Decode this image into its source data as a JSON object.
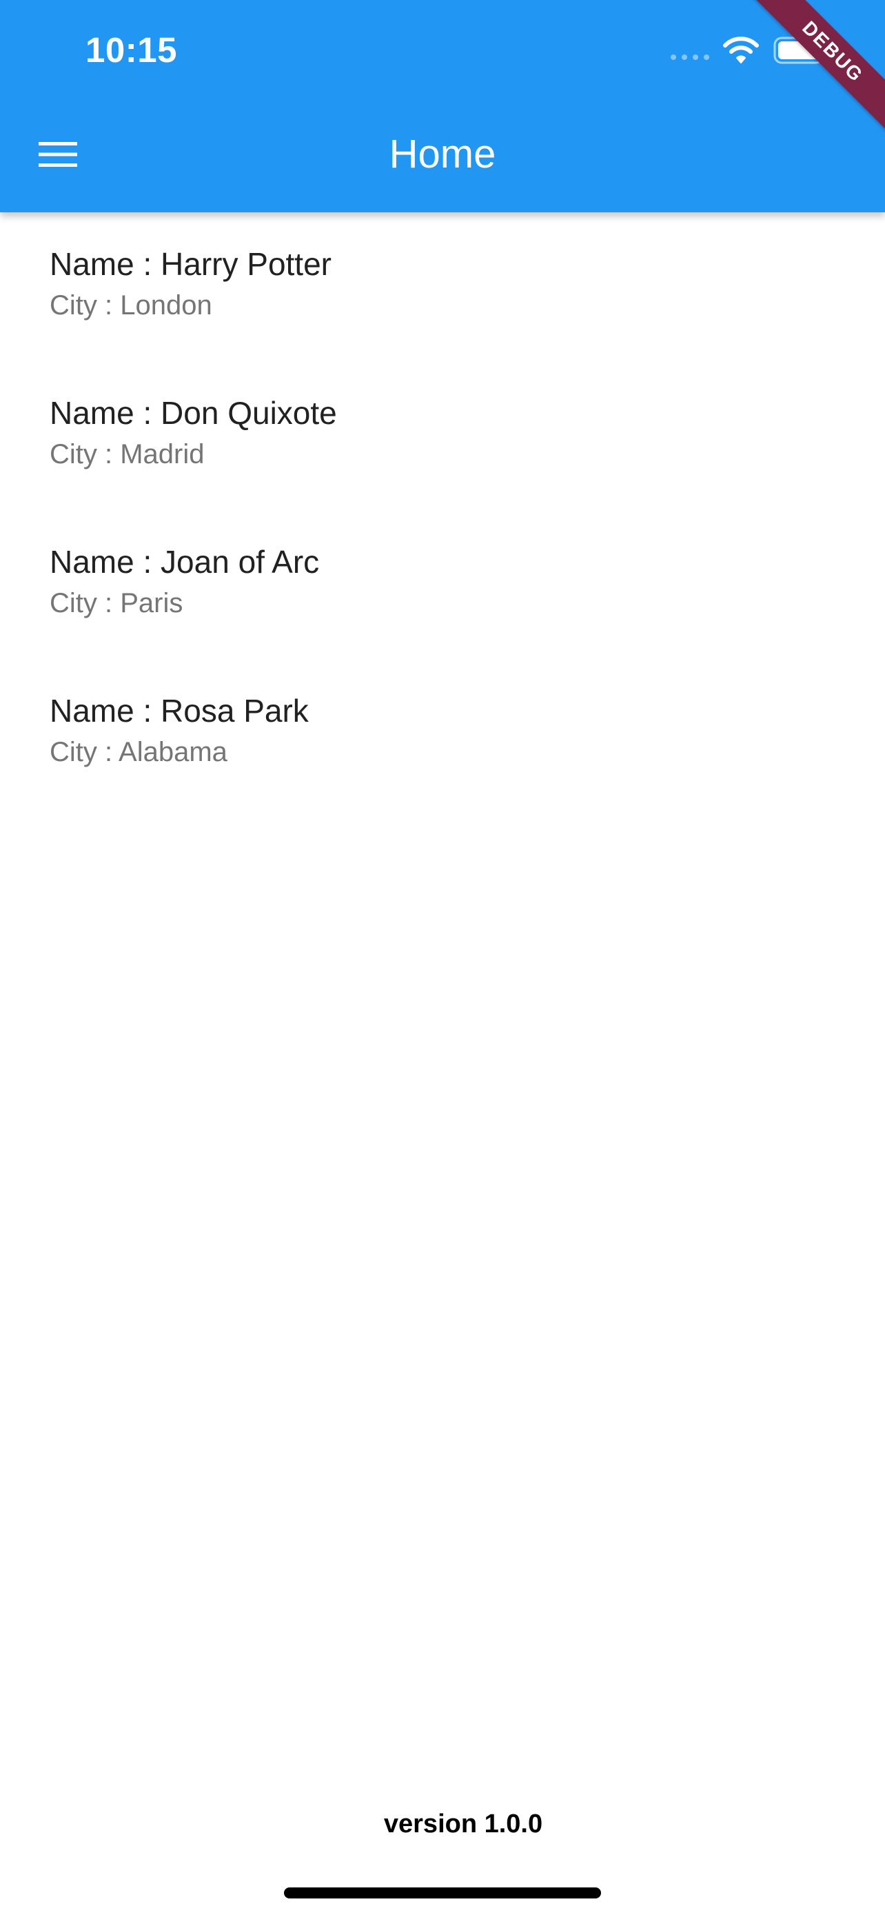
{
  "status_bar": {
    "time": "10:15",
    "icons": [
      "signal-dots-icon",
      "wifi-icon",
      "battery-icon"
    ]
  },
  "app_bar": {
    "title": "Home",
    "menu_icon": "hamburger-menu-icon",
    "background_color": "#2196F3",
    "foreground_color": "#FFFFFF"
  },
  "debug_banner": {
    "label": "DEBUG",
    "color": "#7D2346"
  },
  "list": {
    "items": [
      {
        "name": "Name : Harry Potter",
        "city": "City : London"
      },
      {
        "name": "Name : Don Quixote",
        "city": "City : Madrid"
      },
      {
        "name": "Name : Joan of Arc",
        "city": "City : Paris"
      },
      {
        "name": "Name : Rosa Park",
        "city": "City : Alabama"
      }
    ]
  },
  "footer": {
    "version": "version 1.0.0"
  }
}
